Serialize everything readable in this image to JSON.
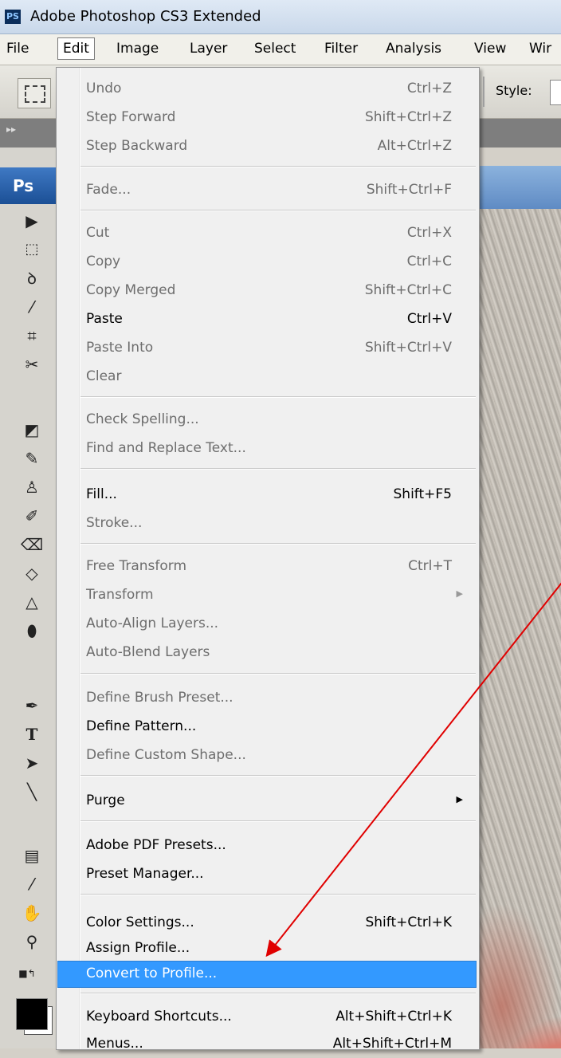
{
  "window": {
    "app_icon": "PS",
    "title": "Adobe Photoshop CS3 Extended"
  },
  "menubar": {
    "items": [
      "File",
      "Edit",
      "Image",
      "Layer",
      "Select",
      "Filter",
      "Analysis",
      "View",
      "Wir"
    ],
    "active": "Edit"
  },
  "options_bar": {
    "style_label": "Style:"
  },
  "toolbox": {
    "header": "Ps",
    "type_tool_glyph": "T"
  },
  "edit_menu": {
    "items": [
      {
        "label": "Undo",
        "shortcut": "Ctrl+Z"
      },
      {
        "label": "Step Forward",
        "shortcut": "Shift+Ctrl+Z"
      },
      {
        "label": "Step Backward",
        "shortcut": "Alt+Ctrl+Z"
      },
      {
        "label": "Fade...",
        "shortcut": "Shift+Ctrl+F"
      },
      {
        "label": "Cut",
        "shortcut": "Ctrl+X"
      },
      {
        "label": "Copy",
        "shortcut": "Ctrl+C"
      },
      {
        "label": "Copy Merged",
        "shortcut": "Shift+Ctrl+C"
      },
      {
        "label": "Paste",
        "shortcut": "Ctrl+V"
      },
      {
        "label": "Paste Into",
        "shortcut": "Shift+Ctrl+V"
      },
      {
        "label": "Clear",
        "shortcut": ""
      },
      {
        "label": "Check Spelling...",
        "shortcut": ""
      },
      {
        "label": "Find and Replace Text...",
        "shortcut": ""
      },
      {
        "label": "Fill...",
        "shortcut": "Shift+F5"
      },
      {
        "label": "Stroke...",
        "shortcut": ""
      },
      {
        "label": "Free Transform",
        "shortcut": "Ctrl+T"
      },
      {
        "label": "Transform",
        "shortcut": ""
      },
      {
        "label": "Auto-Align Layers...",
        "shortcut": ""
      },
      {
        "label": "Auto-Blend Layers",
        "shortcut": ""
      },
      {
        "label": "Define Brush Preset...",
        "shortcut": ""
      },
      {
        "label": "Define Pattern...",
        "shortcut": ""
      },
      {
        "label": "Define Custom Shape...",
        "shortcut": ""
      },
      {
        "label": "Purge",
        "shortcut": ""
      },
      {
        "label": "Adobe PDF Presets...",
        "shortcut": ""
      },
      {
        "label": "Preset Manager...",
        "shortcut": ""
      },
      {
        "label": "Color Settings...",
        "shortcut": "Shift+Ctrl+K"
      },
      {
        "label": "Assign Profile...",
        "shortcut": ""
      },
      {
        "label": "Convert to Profile...",
        "shortcut": ""
      },
      {
        "label": "Keyboard Shortcuts...",
        "shortcut": "Alt+Shift+Ctrl+K"
      },
      {
        "label": "Menus...",
        "shortcut": "Alt+Shift+Ctrl+M"
      }
    ]
  },
  "colors": {
    "highlight": "#3399ff",
    "annotation_arrow": "#e00000",
    "disabled_text": "#6d6d6d"
  }
}
